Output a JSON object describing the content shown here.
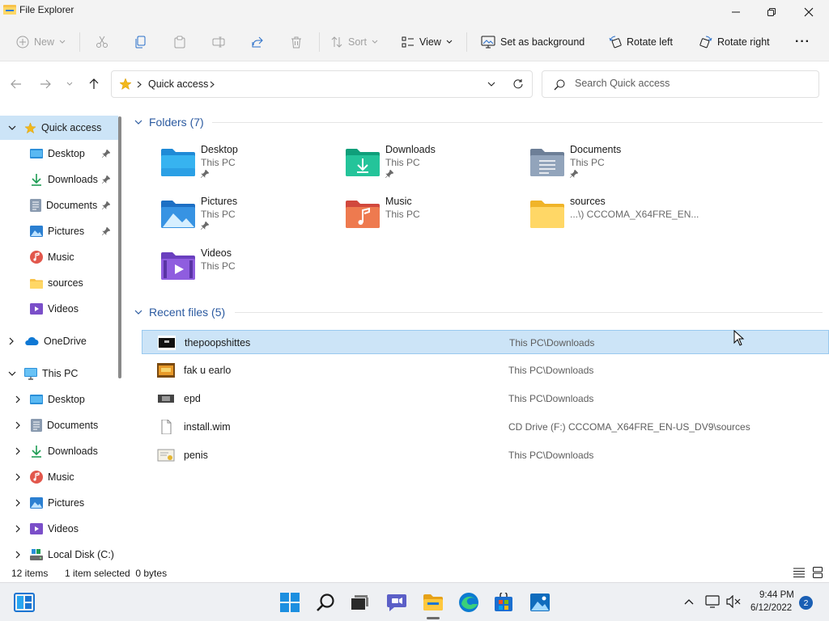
{
  "window": {
    "title": "File Explorer"
  },
  "toolbar": {
    "new_label": "New",
    "sort_label": "Sort",
    "view_label": "View",
    "set_background_label": "Set as background",
    "rotate_left_label": "Rotate left",
    "rotate_right_label": "Rotate right",
    "more_label": "···"
  },
  "address": {
    "location": "Quick access",
    "search_placeholder": "Search Quick access"
  },
  "sidebar": {
    "items": [
      {
        "label": "Quick access",
        "icon": "star-icon"
      },
      {
        "label": "Desktop",
        "icon": "desktop-icon"
      },
      {
        "label": "Downloads",
        "icon": "downloads-icon"
      },
      {
        "label": "Documents",
        "icon": "documents-icon"
      },
      {
        "label": "Pictures",
        "icon": "pictures-icon"
      },
      {
        "label": "Music",
        "icon": "music-icon"
      },
      {
        "label": "sources",
        "icon": "folder-icon"
      },
      {
        "label": "Videos",
        "icon": "videos-icon"
      },
      {
        "label": "OneDrive",
        "icon": "cloud-icon"
      },
      {
        "label": "This PC",
        "icon": "computer-icon"
      },
      {
        "label": "Desktop",
        "icon": "desktop-icon"
      },
      {
        "label": "Documents",
        "icon": "documents-icon"
      },
      {
        "label": "Downloads",
        "icon": "downloads-icon"
      },
      {
        "label": "Music",
        "icon": "music-icon"
      },
      {
        "label": "Pictures",
        "icon": "pictures-icon"
      },
      {
        "label": "Videos",
        "icon": "videos-icon"
      },
      {
        "label": "Local Disk (C:)",
        "icon": "disk-icon"
      }
    ]
  },
  "folders": {
    "header": "Folders (7)",
    "items": [
      {
        "name": "Desktop",
        "location": "This PC",
        "pinned": true
      },
      {
        "name": "Downloads",
        "location": "This PC",
        "pinned": true
      },
      {
        "name": "Documents",
        "location": "This PC",
        "pinned": true
      },
      {
        "name": "Pictures",
        "location": "This PC",
        "pinned": true
      },
      {
        "name": "Music",
        "location": "This PC",
        "pinned": false
      },
      {
        "name": "sources",
        "location": "...\\) CCCOMA_X64FRE_EN...",
        "pinned": false
      },
      {
        "name": "Videos",
        "location": "This PC",
        "pinned": false
      }
    ]
  },
  "recent": {
    "header": "Recent files (5)",
    "items": [
      {
        "name": "thepoopshittes",
        "location": "This PC\\Downloads",
        "selected": true
      },
      {
        "name": "fak u earlo",
        "location": "This PC\\Downloads",
        "selected": false
      },
      {
        "name": "epd",
        "location": "This PC\\Downloads",
        "selected": false
      },
      {
        "name": "install.wim",
        "location": "CD Drive (F:) CCCOMA_X64FRE_EN-US_DV9\\sources",
        "selected": false
      },
      {
        "name": "penis",
        "location": "This PC\\Downloads",
        "selected": false
      }
    ]
  },
  "status": {
    "item_count": "12 items",
    "selection": "1 item selected  0 bytes"
  },
  "taskbar": {
    "time": "9:44 PM",
    "date": "6/12/2022",
    "notification_count": "2"
  },
  "colors": {
    "accent": "#0067c0",
    "selection": "#cce4f7",
    "section_header": "#2b5aa0",
    "folder_yellow": "#f8c24a"
  }
}
